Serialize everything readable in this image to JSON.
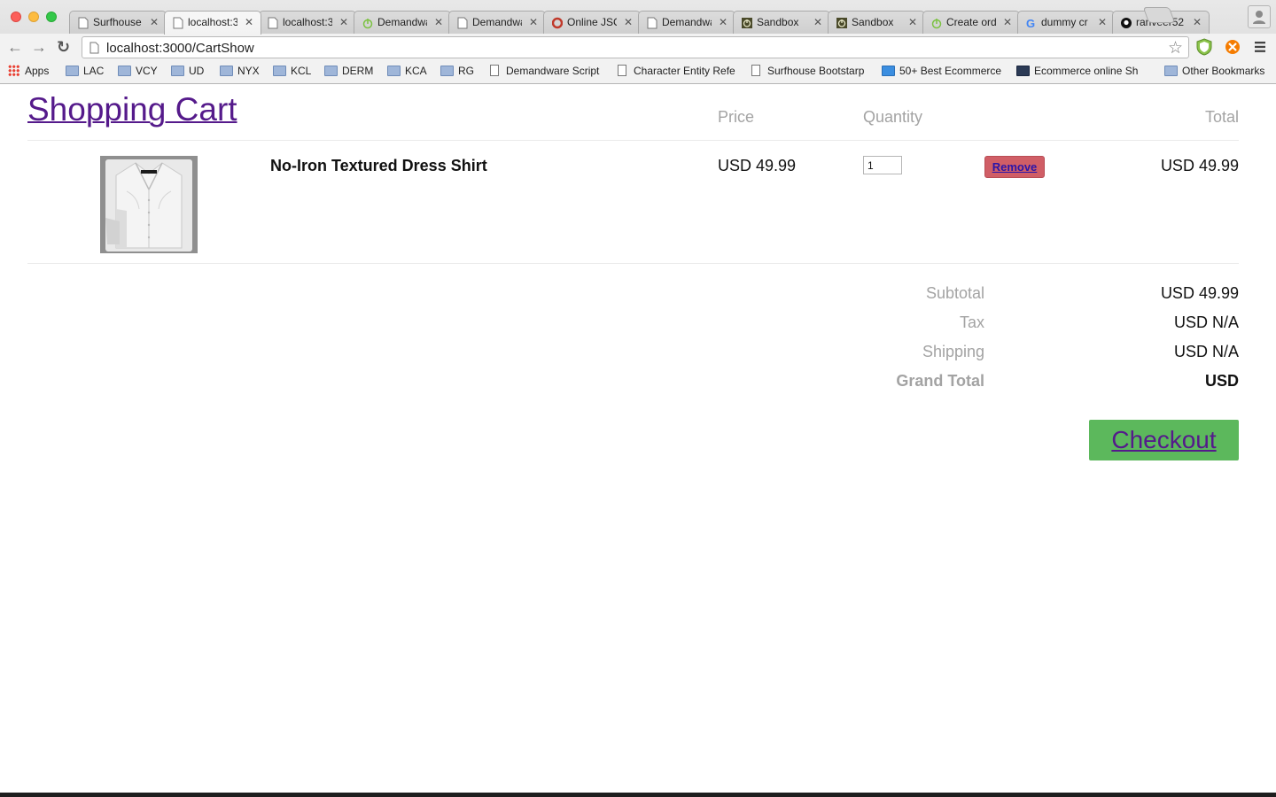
{
  "browser": {
    "tabs": [
      {
        "title": "Surfhouse",
        "icon": "document-icon"
      },
      {
        "title": "localhost:3",
        "icon": "document-icon",
        "active": true
      },
      {
        "title": "localhost:3",
        "icon": "document-icon"
      },
      {
        "title": "Demandwa",
        "icon": "power-icon"
      },
      {
        "title": "Demandwa",
        "icon": "document-icon"
      },
      {
        "title": "Online JSC",
        "icon": "red-circle-icon"
      },
      {
        "title": "Demandwa",
        "icon": "document-icon"
      },
      {
        "title": "Sandbox",
        "icon": "dark-power-icon"
      },
      {
        "title": "Sandbox",
        "icon": "dark-power-icon"
      },
      {
        "title": "Create ord",
        "icon": "power-icon"
      },
      {
        "title": "dummy cr",
        "icon": "google-icon"
      },
      {
        "title": "ranveer52",
        "icon": "github-icon"
      }
    ],
    "url": "localhost:3000/CartShow",
    "bookmarks": [
      {
        "label": "Apps",
        "type": "apps"
      },
      {
        "label": "LAC",
        "type": "folder"
      },
      {
        "label": "VCY",
        "type": "folder"
      },
      {
        "label": "UD",
        "type": "folder"
      },
      {
        "label": "NYX",
        "type": "folder"
      },
      {
        "label": "KCL",
        "type": "folder"
      },
      {
        "label": "DERM",
        "type": "folder"
      },
      {
        "label": "KCA",
        "type": "folder"
      },
      {
        "label": "RG",
        "type": "folder"
      },
      {
        "label": "Demandware Script",
        "type": "page"
      },
      {
        "label": "Character Entity Refe",
        "type": "page"
      },
      {
        "label": "Surfhouse Bootstarp",
        "type": "page"
      },
      {
        "label": "50+ Best Ecommerce",
        "type": "page"
      },
      {
        "label": "Ecommerce online Sh",
        "type": "page"
      },
      {
        "label": "Other Bookmarks",
        "type": "folder"
      }
    ]
  },
  "cart": {
    "title": "Shopping Cart",
    "headers": {
      "price": "Price",
      "quantity": "Quantity",
      "total": "Total"
    },
    "items": [
      {
        "name": "No-Iron Textured Dress Shirt",
        "price": "USD 49.99",
        "quantity": "1",
        "remove_label": "Remove",
        "total": "USD 49.99"
      }
    ],
    "summary": {
      "subtotal_label": "Subtotal",
      "subtotal": "USD 49.99",
      "tax_label": "Tax",
      "tax": "USD N/A",
      "shipping_label": "Shipping",
      "shipping": "USD N/A",
      "grand_total_label": "Grand Total",
      "grand_total": "USD"
    },
    "checkout_label": "Checkout"
  },
  "colors": {
    "link": "#551a8b",
    "remove_button": "#d05e66",
    "checkout_button": "#5cb85c",
    "muted_text": "#a3a3a3"
  }
}
